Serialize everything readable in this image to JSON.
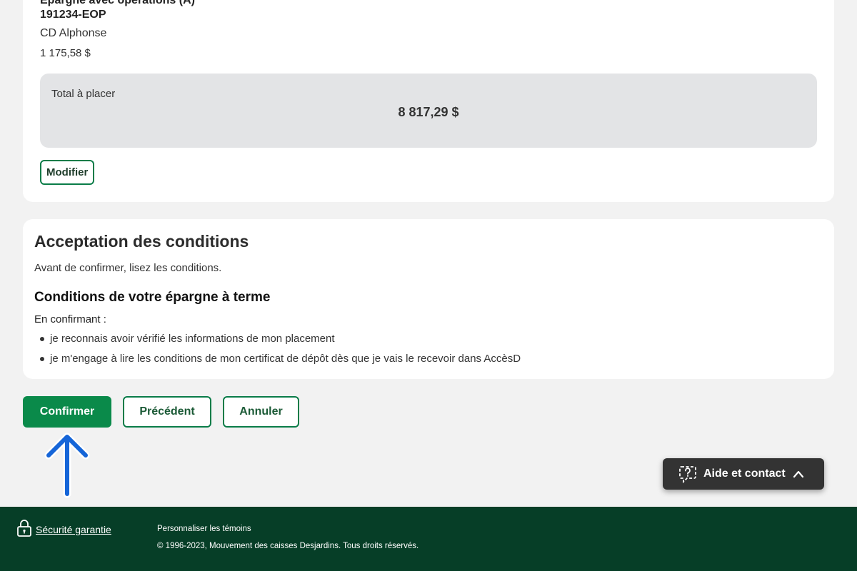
{
  "summary": {
    "account_name": "Épargne avec opérations (A)",
    "account_number": "191234-EOP",
    "account_holder": "CD Alphonse",
    "account_amount": "1 175,58 $",
    "total_label": "Total à placer",
    "total_value": "8 817,29 $",
    "modify_label": "Modifier"
  },
  "conditions": {
    "title": "Acceptation des conditions",
    "intro": "Avant de confirmer, lisez les conditions.",
    "subtitle": "Conditions de votre épargne à terme",
    "lead": "En confirmant :",
    "items": [
      "je reconnais avoir vérifié les informations de mon placement",
      "je m'engage à lire les conditions de mon certificat de dépôt dès que je vais le recevoir dans AccèsD"
    ]
  },
  "actions": {
    "confirm_label": "Confirmer",
    "previous_label": "Précédent",
    "cancel_label": "Annuler"
  },
  "help": {
    "label": "Aide et contact",
    "icon": "help-chat-icon"
  },
  "footer": {
    "security_label": "Sécurité garantie",
    "cookies_label": "Personnaliser les témoins",
    "copyright": "© 1996-2023, Mouvement des caisses Desjardins. Tous droits réservés."
  },
  "colors": {
    "brand_green": "#0a8a4a",
    "footer_green": "#063e27",
    "arrow_blue": "#1565d8"
  }
}
